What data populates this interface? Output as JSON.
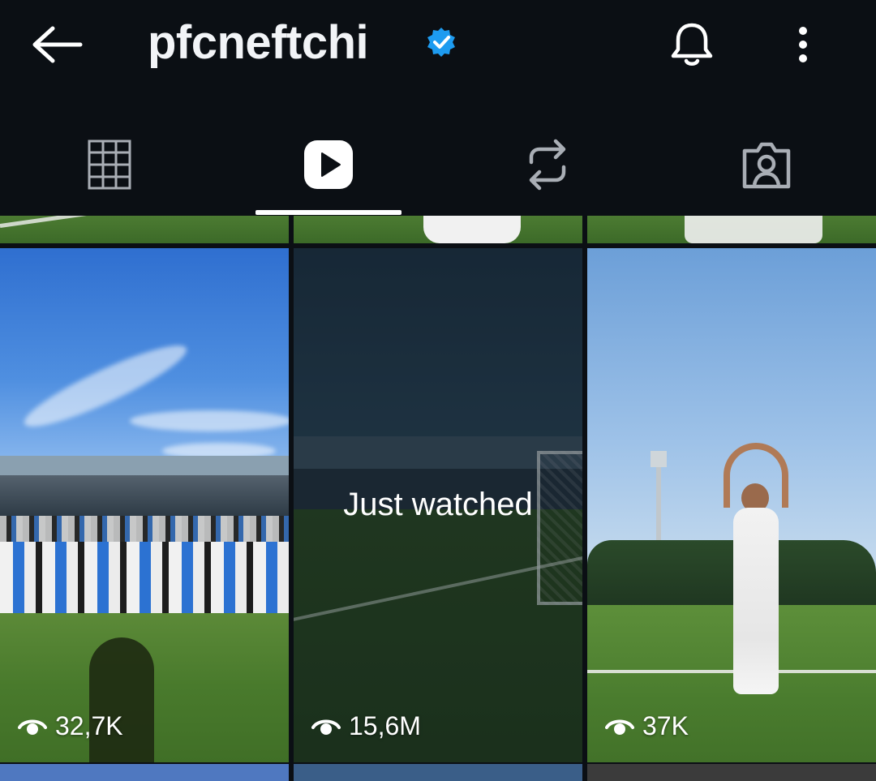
{
  "header": {
    "username": "pfcneftchi",
    "verified": true,
    "icons": [
      "back-arrow-icon",
      "verified-badge-icon",
      "bell-icon",
      "more-vertical-icon"
    ]
  },
  "tabs": [
    {
      "name": "posts-grid",
      "icon": "grid-icon",
      "active": false
    },
    {
      "name": "reels",
      "icon": "reels-play-icon",
      "active": true
    },
    {
      "name": "reposts",
      "icon": "repost-icon",
      "active": false
    },
    {
      "name": "tagged",
      "icon": "tagged-person-icon",
      "active": false
    }
  ],
  "grid": {
    "items": [
      {
        "views": "32,7K",
        "overlay": ""
      },
      {
        "views": "15,6M",
        "overlay": "Just watched"
      },
      {
        "views": "37K",
        "overlay": ""
      }
    ]
  },
  "colors": {
    "background": "#0b0f14",
    "verified_blue": "#1d9bf0",
    "active_indicator": "#ffffff",
    "inactive_icon": "#a9aeb5"
  }
}
